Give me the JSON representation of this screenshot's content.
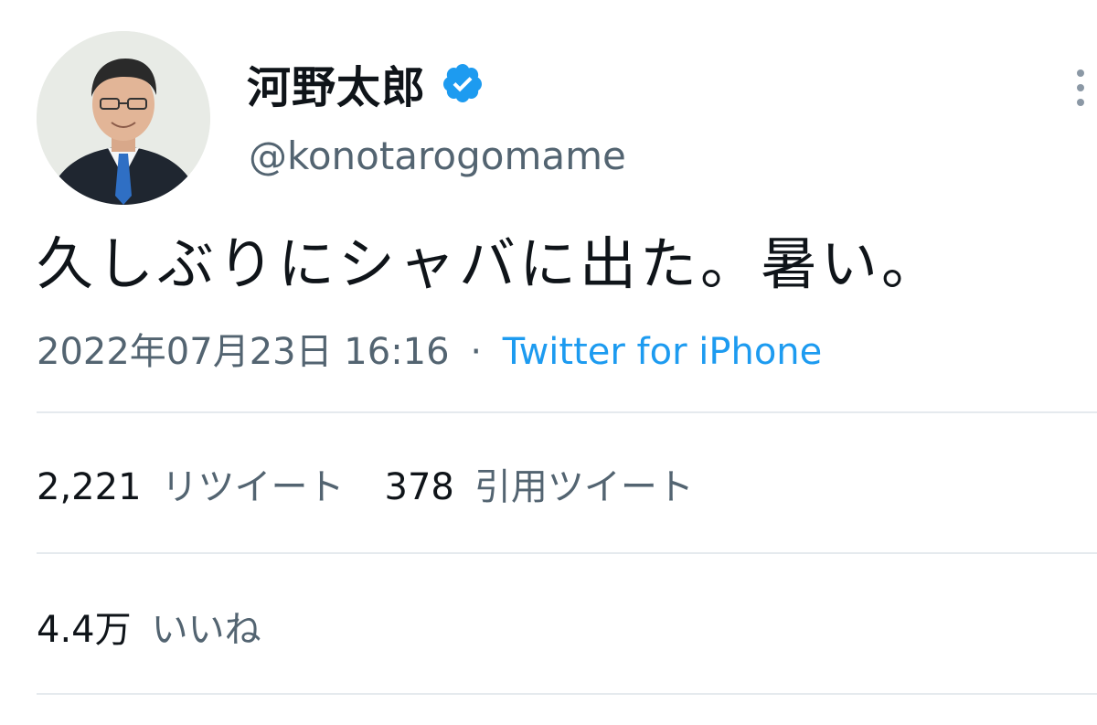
{
  "tweet": {
    "display_name": "河野太郎",
    "handle": "@konotarogomame",
    "text": "久しぶりにシャバに出た。暑い。",
    "timestamp": "2022年07月23日 16:16",
    "separator": "·",
    "source": "Twitter for iPhone"
  },
  "icons": {
    "verified": "verified-badge-icon",
    "more": "more-options-icon",
    "avatar": "profile-photo"
  },
  "stats": {
    "retweets_count": "2,221",
    "retweets_label": "リツイート",
    "quotes_count": "378",
    "quotes_label": "引用ツイート",
    "likes_count": "4.4万",
    "likes_label": "いいね"
  },
  "colors": {
    "text": "#0f1419",
    "secondary": "#536471",
    "accent": "#1d9bf0",
    "divider": "#e5eaee"
  }
}
